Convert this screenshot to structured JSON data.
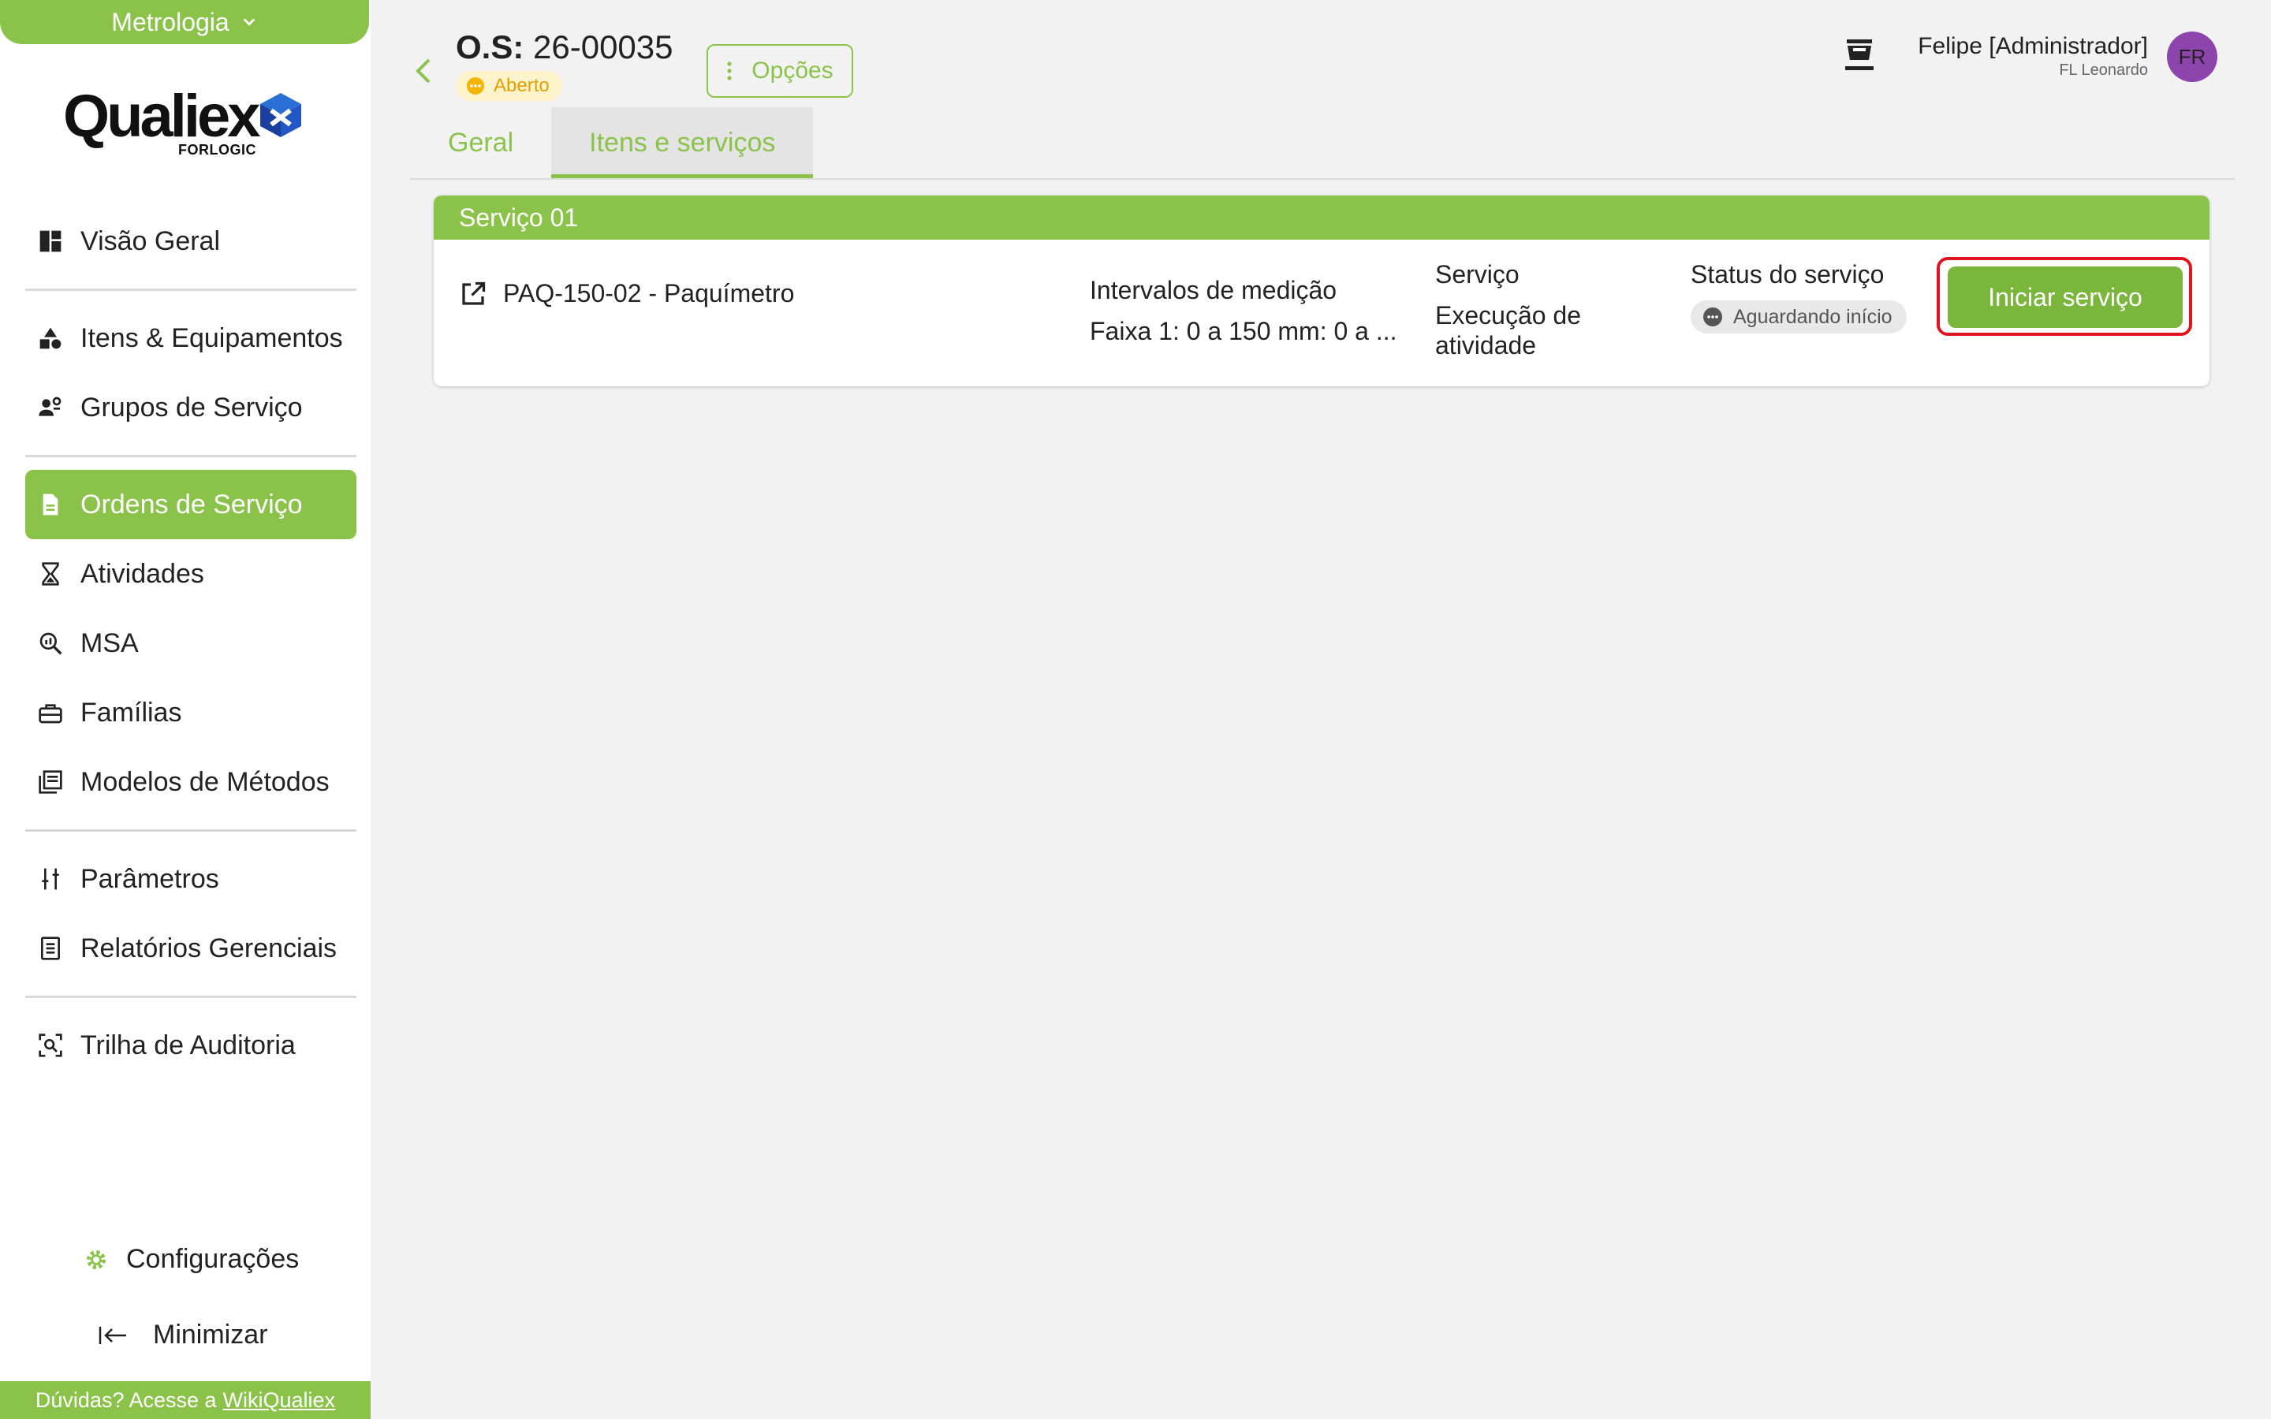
{
  "app": {
    "module_label": "Metrologia",
    "logo_text": "Qualiex",
    "logo_subtext": "FORLOGIC"
  },
  "sidebar": {
    "items": [
      {
        "label": "Visão Geral",
        "icon": "dashboard-icon"
      },
      {
        "label": "Itens & Equipamentos",
        "icon": "shapes-icon"
      },
      {
        "label": "Grupos de Serviço",
        "icon": "people-settings-icon"
      },
      {
        "label": "Ordens de Serviço",
        "icon": "document-icon",
        "active": true
      },
      {
        "label": "Atividades",
        "icon": "hourglass-icon"
      },
      {
        "label": "MSA",
        "icon": "zoom-analysis-icon"
      },
      {
        "label": "Famílias",
        "icon": "toolbox-icon"
      },
      {
        "label": "Modelos de Métodos",
        "icon": "library-books-icon"
      },
      {
        "label": "Parâmetros",
        "icon": "sliders-icon"
      },
      {
        "label": "Relatórios Gerenciais",
        "icon": "report-icon"
      },
      {
        "label": "Trilha de Auditoria",
        "icon": "audit-scan-icon"
      }
    ],
    "config_label": "Configurações",
    "minimize_label": "Minimizar",
    "help_text": "Dúvidas? Acesse a",
    "help_link": "WikiQualiex"
  },
  "header": {
    "os_prefix": "O.S:",
    "os_number": "26-00035",
    "status": "Aberto",
    "options_label": "Opções",
    "user_name": "Felipe [Administrador]",
    "user_sub": "FL Leonardo",
    "avatar_initials": "FR"
  },
  "tabs": [
    {
      "label": "Geral",
      "active": false
    },
    {
      "label": "Itens e serviços",
      "active": true
    }
  ],
  "service_card": {
    "title": "Serviço 01",
    "item": "PAQ-150-02 - Paquímetro",
    "intervals_label": "Intervalos de medição",
    "intervals_value": "Faixa 1: 0 a 150 mm: 0 a ...",
    "service_label": "Serviço",
    "service_value": "Execução de atividade",
    "status_label": "Status do serviço",
    "status_value": "Aguardando início",
    "start_button": "Iniciar serviço"
  },
  "colors": {
    "accent": "#8bc34a",
    "highlight": "#e0141e",
    "avatar": "#8e44ad",
    "status_open": "#f5b400"
  }
}
